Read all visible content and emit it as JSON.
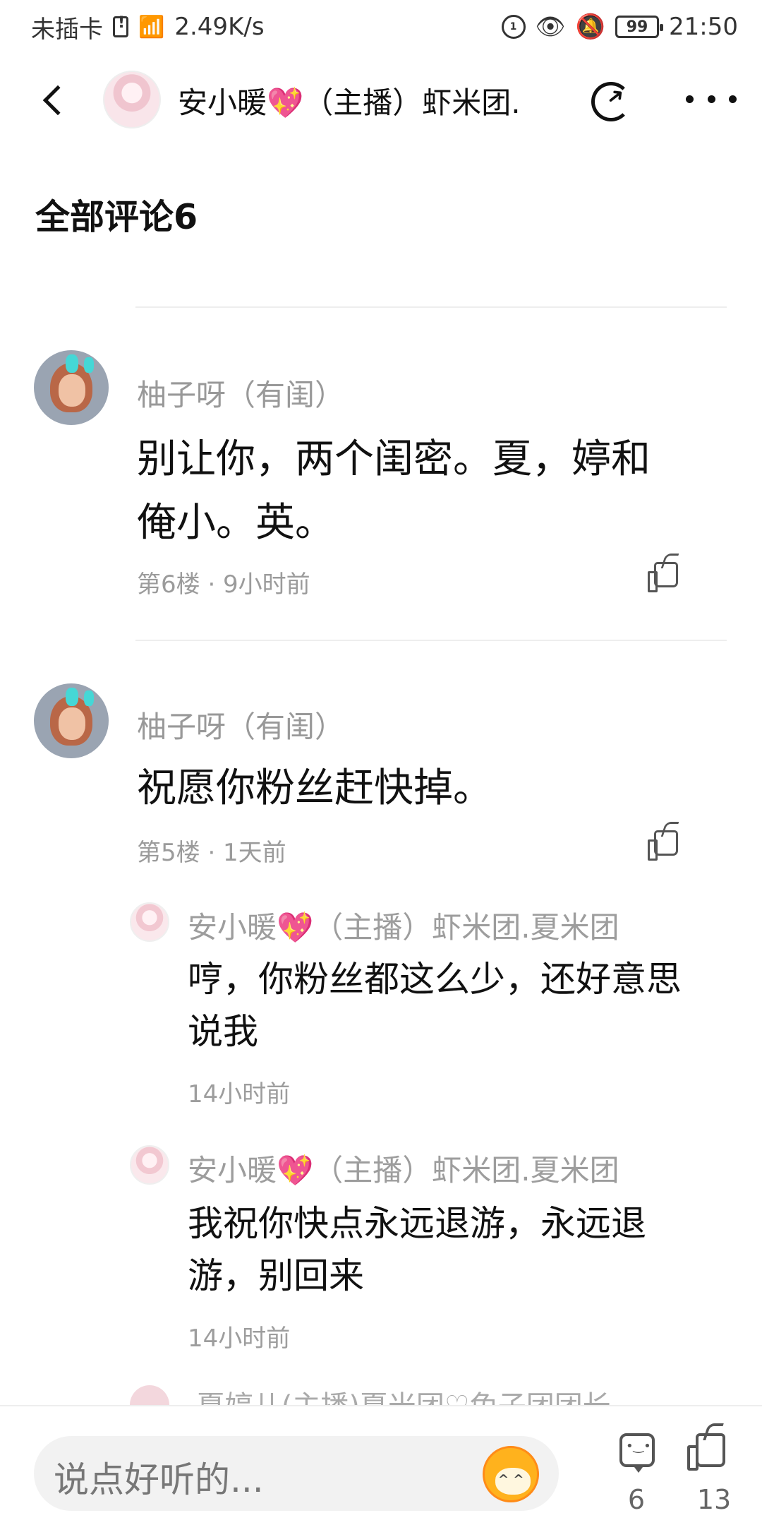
{
  "status": {
    "carrier": "未插卡",
    "speed": "2.49K/s",
    "battery": "99",
    "time": "21:50"
  },
  "header": {
    "title": "安小暖💖（主播）虾米团."
  },
  "comments_section": {
    "title": "全部评论6"
  },
  "comments": [
    {
      "user": "柚子呀（有闺）",
      "text": "别让你，两个闺密。夏，婷和俺小。英。",
      "meta": "第6楼 · 9小时前"
    },
    {
      "user": "柚子呀（有闺）",
      "text": "祝愿你粉丝赶快掉。",
      "meta": "第5楼 · 1天前",
      "replies": [
        {
          "user": "安小暖💖（主播）虾米团.夏米团",
          "text": "哼，你粉丝都这么少，还好意思说我",
          "meta": "14小时前"
        },
        {
          "user": "安小暖💖（主播）虾米团.夏米团",
          "text": "我祝你快点永远退游，永远退游，别回来",
          "meta": "14小时前"
        }
      ]
    }
  ],
  "partial_reply": {
    "user": "夏婷儿(主播)夏米团♡兔子团团长"
  },
  "bottom_bar": {
    "placeholder": "说点好听的...",
    "comment_count": "6",
    "like_count": "13"
  }
}
